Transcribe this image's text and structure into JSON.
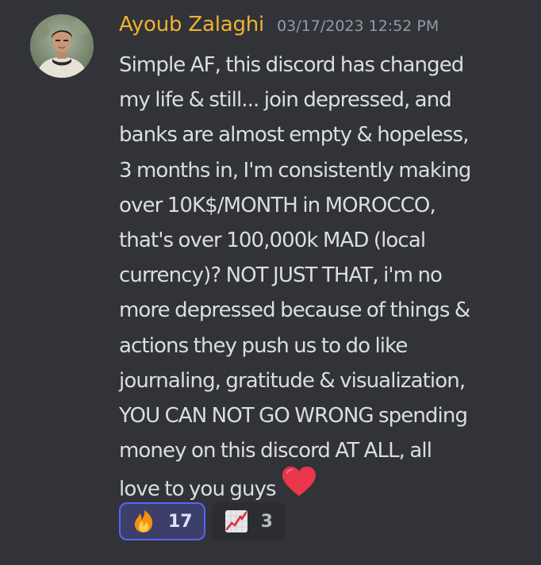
{
  "message": {
    "username": "Ayoub Zalaghi",
    "timestamp": "03/17/2023 12:52 PM",
    "avatar_icon": "user-avatar-photo",
    "lines": [
      "Simple AF, this discord has changed",
      "my life & still... join depressed, and",
      "banks are almost empty & hopeless,",
      "3 months in, I'm consistently making",
      "over 10K$/MONTH in MOROCCO,",
      "that's over 100,000k MAD (local",
      "currency)? NOT JUST THAT, i'm no",
      "more depressed because of things &",
      "actions they push us to do like",
      "journaling, gratitude & visualization,",
      "YOU CAN NOT GO WRONG spending",
      "money on this discord AT ALL, all",
      "love to you guys"
    ],
    "trailing_emoji": "red-heart-icon"
  },
  "reactions": [
    {
      "emoji": "fire-icon",
      "count": "17",
      "active": true
    },
    {
      "emoji": "chart-increasing-icon",
      "count": "3",
      "active": false
    }
  ],
  "colors": {
    "background": "#313338",
    "username": "#f0b232",
    "timestamp": "#949ba4",
    "text": "#dbdee1",
    "reaction_active_bg": "#3b3f6a",
    "reaction_active_border": "#5865f2",
    "reaction_bg": "#2b2d31",
    "heart": "#e8364a"
  }
}
